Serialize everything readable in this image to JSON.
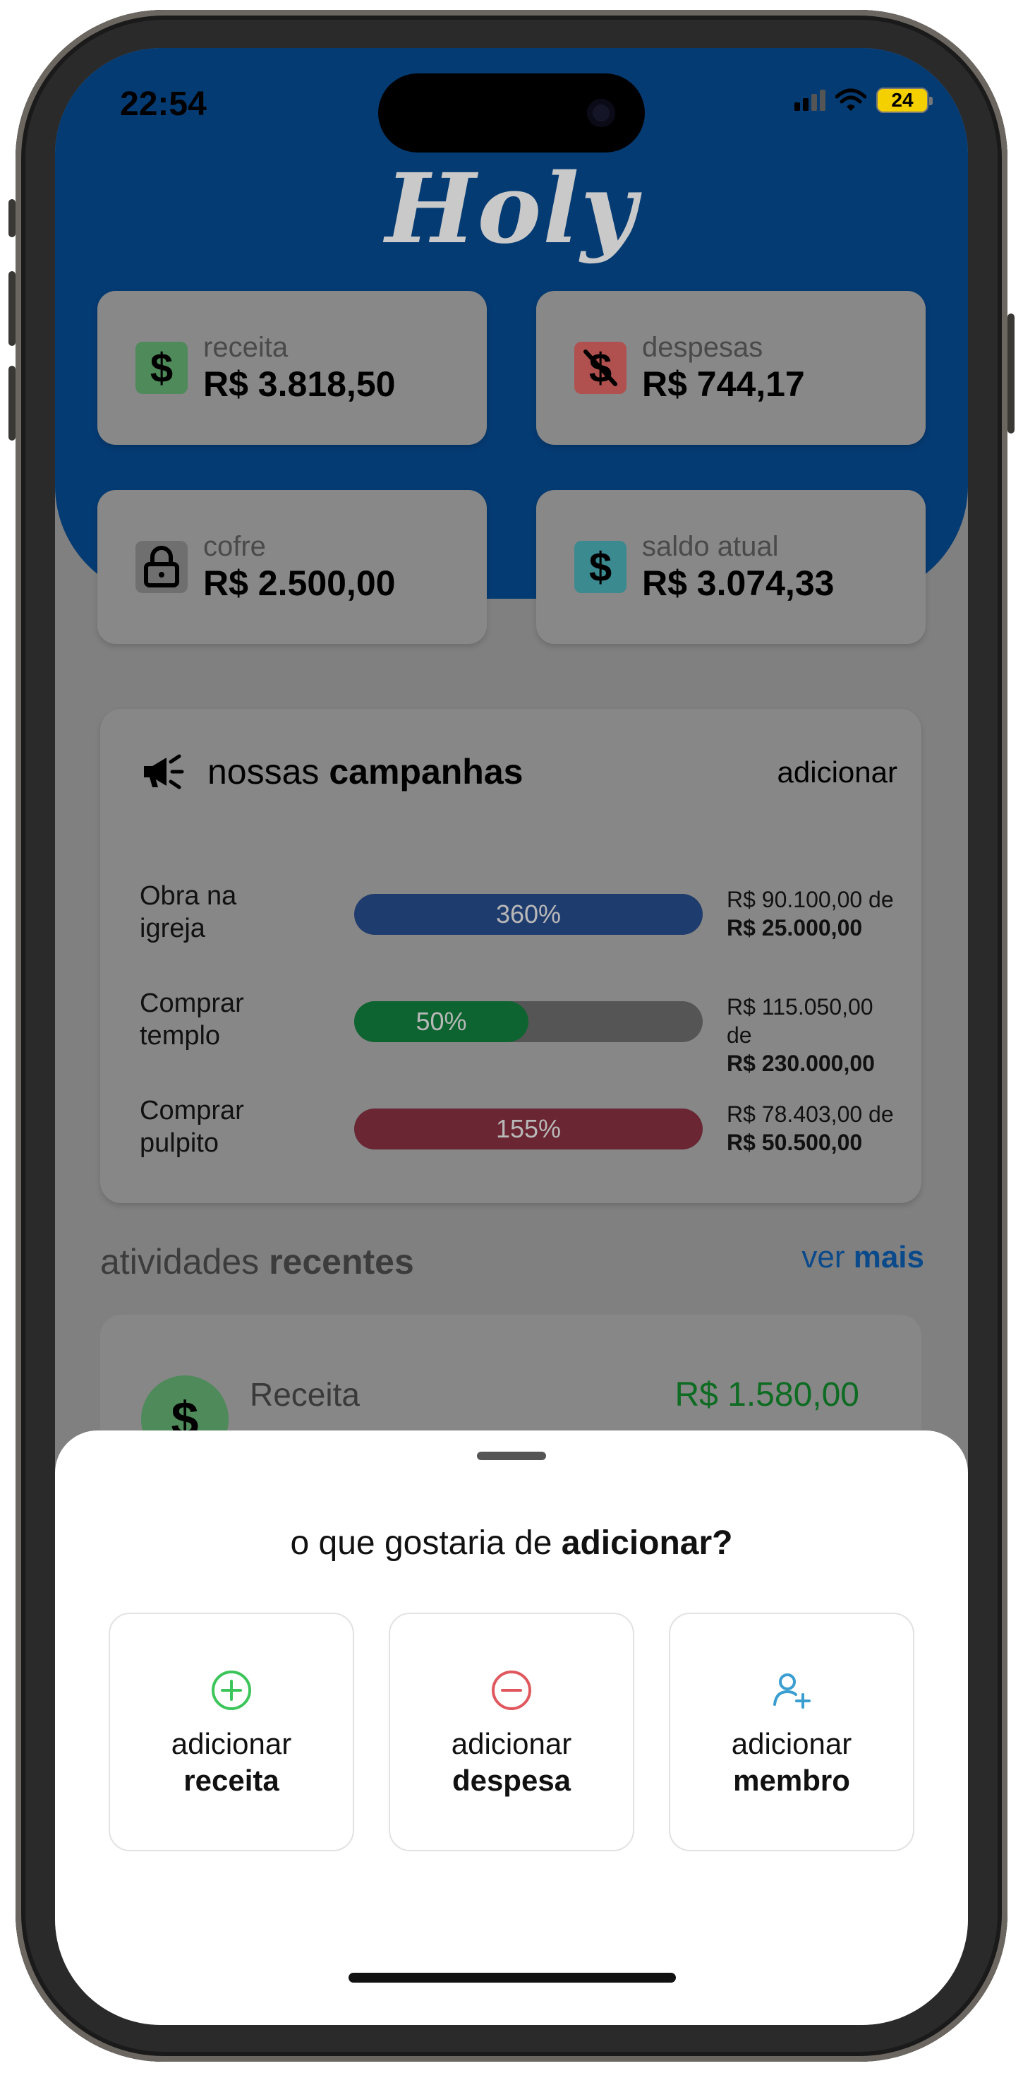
{
  "status_bar": {
    "time": "22:54",
    "battery": "24"
  },
  "app": {
    "logo": "Holy"
  },
  "stats": [
    {
      "label": "receita",
      "value": "R$ 3.818,50",
      "icon": "dollar-icon",
      "icon_color": "#4e8a5a"
    },
    {
      "label": "despesas",
      "value": "R$ 744,17",
      "icon": "dollar-off-icon",
      "icon_color": "#b0514f"
    },
    {
      "label": "cofre",
      "value": "R$ 2.500,00",
      "icon": "lock-icon",
      "icon_color": "#6f6f6f"
    },
    {
      "label": "saldo atual",
      "value": "R$ 3.074,33",
      "icon": "dollar-icon",
      "icon_color": "#3a8a90"
    }
  ],
  "campaigns": {
    "title_normal": "nossas",
    "title_bold": "campanhas",
    "add_label": "adicionar",
    "items": [
      {
        "name_line1": "Obra na",
        "name_line2": "igreja",
        "percent_label": "360%",
        "fill": 1.0,
        "color": "#1f3c6e",
        "amount": "R$ 90.100,00 de",
        "goal": "R$ 25.000,00"
      },
      {
        "name_line1": "Comprar",
        "name_line2": "templo",
        "percent_label": "50%",
        "fill": 0.5,
        "color": "#0e6430",
        "amount": "R$ 115.050,00 de",
        "goal": "R$ 230.000,00"
      },
      {
        "name_line1": "Comprar",
        "name_line2": "pulpito",
        "percent_label": "155%",
        "fill": 1.0,
        "color": "#6a2632",
        "amount": "R$ 78.403,00 de",
        "goal": "R$ 50.500,00"
      }
    ]
  },
  "recent": {
    "title_normal": "atividades",
    "title_bold": "recentes",
    "more_normal": "ver",
    "more_bold": "mais",
    "first_item": {
      "label": "Receita",
      "amount": "R$ 1.580,00"
    }
  },
  "sheet": {
    "title_normal": "o que gostaria de",
    "title_bold": "adicionar?",
    "options": [
      {
        "line1": "adicionar",
        "line2": "receita",
        "icon": "plus-circle-icon",
        "color": "#3cc55a"
      },
      {
        "line1": "adicionar",
        "line2": "despesa",
        "icon": "minus-circle-icon",
        "color": "#e0585e"
      },
      {
        "line1": "adicionar",
        "line2": "membro",
        "icon": "add-user-icon",
        "color": "#3a9ed0"
      }
    ]
  }
}
